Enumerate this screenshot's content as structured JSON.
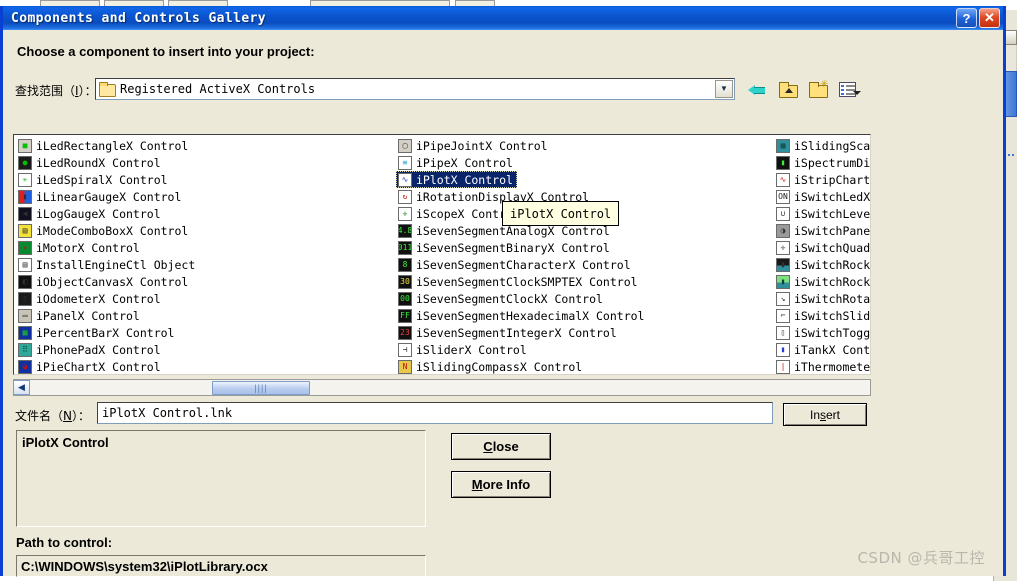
{
  "window": {
    "title": "Components and Controls Gallery",
    "help_button": "?",
    "close_button": "✕"
  },
  "prompt": "Choose a component to insert into your project:",
  "lookin": {
    "label_prefix": "查找范围",
    "label_accel": "I",
    "label_suffix": "）：",
    "value": "Registered ActiveX Controls",
    "folder_icon": "folder-icon",
    "dropdown_arrow": "▼"
  },
  "toolbar": {
    "back": "back-arrow-icon",
    "up_folder": "up-one-level-icon",
    "new_folder": "create-new-folder-icon",
    "views": "views-menu-icon"
  },
  "list": {
    "columns": [
      {
        "name": "column-1",
        "items": [
          {
            "label": "iLedRectangleX Control",
            "icon": "led-rectangle-icon",
            "selected": false
          },
          {
            "label": "iLedRoundX Control",
            "icon": "led-round-icon",
            "selected": false
          },
          {
            "label": "iLedSpiralX Control",
            "icon": "led-spiral-icon",
            "selected": false
          },
          {
            "label": "iLinearGaugeX Control",
            "icon": "linear-gauge-icon",
            "selected": false
          },
          {
            "label": "iLogGaugeX Control",
            "icon": "log-gauge-icon",
            "selected": false
          },
          {
            "label": "iModeComboBoxX Control",
            "icon": "mode-combobox-icon",
            "selected": false
          },
          {
            "label": "iMotorX Control",
            "icon": "motor-icon",
            "selected": false
          },
          {
            "label": "InstallEngineCtl Object",
            "icon": "install-engine-icon",
            "selected": false
          },
          {
            "label": "iObjectCanvasX Control",
            "icon": "object-canvas-icon",
            "selected": false
          },
          {
            "label": "iOdometerX Control",
            "icon": "odometer-icon",
            "selected": false
          },
          {
            "label": "iPanelX Control",
            "icon": "panel-icon",
            "selected": false
          },
          {
            "label": "iPercentBarX Control",
            "icon": "percent-bar-icon",
            "selected": false
          },
          {
            "label": "iPhonePadX Control",
            "icon": "phone-pad-icon",
            "selected": false
          },
          {
            "label": "iPieChartX Control",
            "icon": "pie-chart-icon",
            "selected": false
          }
        ]
      },
      {
        "name": "column-2",
        "items": [
          {
            "label": "iPipeJointX Control",
            "icon": "pipe-joint-icon",
            "selected": false
          },
          {
            "label": "iPipeX Control",
            "icon": "pipe-icon",
            "selected": false
          },
          {
            "label": "iPlotX Control",
            "icon": "plot-icon",
            "selected": true
          },
          {
            "label": "iRotationDisplayX Control",
            "icon": "rotation-display-icon",
            "selected": false
          },
          {
            "label": "iScopeX Control",
            "icon": "scope-icon",
            "selected": false
          },
          {
            "label": "iSevenSegmentAnalogX Control",
            "icon": "seven-segment-analog-icon",
            "selected": false
          },
          {
            "label": "iSevenSegmentBinaryX Control",
            "icon": "seven-segment-binary-icon",
            "selected": false
          },
          {
            "label": "iSevenSegmentCharacterX Control",
            "icon": "seven-segment-character-icon",
            "selected": false
          },
          {
            "label": "iSevenSegmentClockSMPTEX Control",
            "icon": "seven-segment-clock-smpte-icon",
            "selected": false
          },
          {
            "label": "iSevenSegmentClockX Control",
            "icon": "seven-segment-clock-icon",
            "selected": false
          },
          {
            "label": "iSevenSegmentHexadecimalX Control",
            "icon": "seven-segment-hex-icon",
            "selected": false
          },
          {
            "label": "iSevenSegmentIntegerX Control",
            "icon": "seven-segment-integer-icon",
            "selected": false
          },
          {
            "label": "iSliderX Control",
            "icon": "slider-icon",
            "selected": false
          },
          {
            "label": "iSlidingCompassX Control",
            "icon": "sliding-compass-icon",
            "selected": false
          }
        ]
      },
      {
        "name": "column-3",
        "items": [
          {
            "label": "iSlidingScal",
            "icon": "sliding-scale-icon",
            "selected": false
          },
          {
            "label": "iSpectrumDis",
            "icon": "spectrum-display-icon",
            "selected": false
          },
          {
            "label": "iStripChartX",
            "icon": "strip-chart-icon",
            "selected": false
          },
          {
            "label": "iSwitchLedX",
            "icon": "switch-led-icon",
            "selected": false
          },
          {
            "label": "iSwitchLever",
            "icon": "switch-lever-icon",
            "selected": false
          },
          {
            "label": "iSwitchPanel",
            "icon": "switch-panel-icon",
            "selected": false
          },
          {
            "label": "iSwitchQuadX",
            "icon": "switch-quad-icon",
            "selected": false
          },
          {
            "label": "iSwitchRocke",
            "icon": "switch-rocker-icon",
            "selected": false
          },
          {
            "label": "iSwitchRocke",
            "icon": "switch-rocker2-icon",
            "selected": false
          },
          {
            "label": "iSwitchRotar",
            "icon": "switch-rotary-icon",
            "selected": false
          },
          {
            "label": "iSwitchSlide",
            "icon": "switch-slide-icon",
            "selected": false
          },
          {
            "label": "iSwitchToggl",
            "icon": "switch-toggle-icon",
            "selected": false
          },
          {
            "label": "iTankX Contr",
            "icon": "tank-icon",
            "selected": false
          },
          {
            "label": "iThermometer",
            "icon": "thermometer-icon",
            "selected": false
          }
        ]
      }
    ],
    "scrollbar": {
      "left_arrow": "◀",
      "thumb_grip": "||||"
    }
  },
  "tooltip": "iPlotX Control",
  "filename": {
    "label_prefix": "文件名",
    "label_accel": "N",
    "label_suffix": "）：",
    "value": "iPlotX Control.lnk"
  },
  "buttons": {
    "insert_pre": "In",
    "insert_accel": "s",
    "insert_post": "ert",
    "close_accel": "C",
    "close_post": "lose",
    "moreinfo_accel": "M",
    "moreinfo_post": "ore Info"
  },
  "description": "iPlotX Control",
  "path": {
    "label": "Path to control:",
    "value": "C:\\WINDOWS\\system32\\iPlotLibrary.ocx"
  },
  "watermark": "CSDN @兵哥工控"
}
